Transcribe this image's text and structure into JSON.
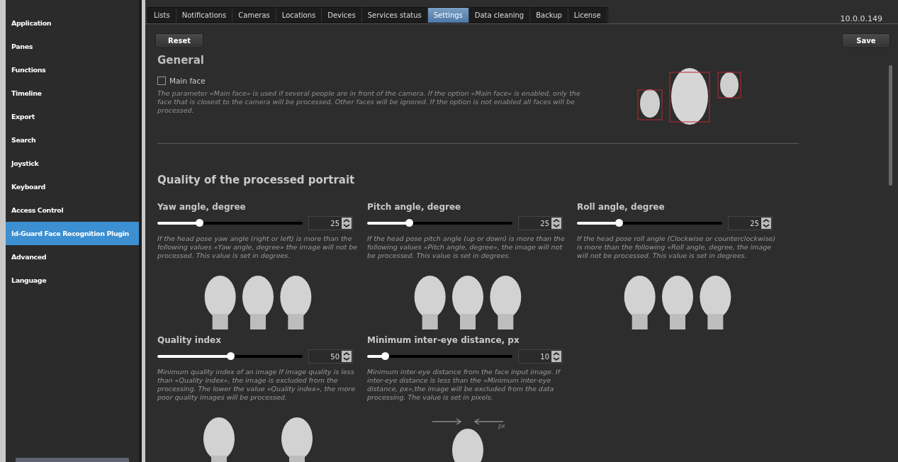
{
  "sidebar": {
    "items": [
      {
        "label": "Application",
        "selected": false
      },
      {
        "label": "Panes",
        "selected": false
      },
      {
        "label": "Functions",
        "selected": false
      },
      {
        "label": "Timeline",
        "selected": false
      },
      {
        "label": "Export",
        "selected": false
      },
      {
        "label": "Search",
        "selected": false
      },
      {
        "label": "Joystick",
        "selected": false
      },
      {
        "label": "Keyboard",
        "selected": false
      },
      {
        "label": "Access Control",
        "selected": false
      },
      {
        "label": "Id-Guard Face Recognition Plugin",
        "selected": true
      },
      {
        "label": "Advanced",
        "selected": false
      },
      {
        "label": "Language",
        "selected": false
      }
    ]
  },
  "tabs": [
    {
      "label": "Lists",
      "selected": false
    },
    {
      "label": "Notifications",
      "selected": false
    },
    {
      "label": "Cameras",
      "selected": false
    },
    {
      "label": "Locations",
      "selected": false
    },
    {
      "label": "Devices",
      "selected": false
    },
    {
      "label": "Services status",
      "selected": false
    },
    {
      "label": "Settings",
      "selected": true
    },
    {
      "label": "Data cleaning",
      "selected": false
    },
    {
      "label": "Backup",
      "selected": false
    },
    {
      "label": "License",
      "selected": false
    }
  ],
  "version": "10.0.0.149",
  "buttons": {
    "reset": "Reset",
    "save": "Save"
  },
  "general": {
    "title": "General",
    "main_face": {
      "label": "Main face",
      "checked": false
    },
    "description": "The parameter «Main face» is used if several people are in front of the camera. If the option «Main face» is enabled, only the face that is closest to the camera will be processed. Other faces will be ignored. If the option is not enabled all faces will be processed."
  },
  "quality": {
    "title": "Quality of the processed portrait",
    "settings": [
      {
        "title": "Yaw angle, degree",
        "level": 0.29,
        "value": "25",
        "description": "If  the head pose yaw angle (right or left) is more than the following values «Yaw angle, degree» the image will not be processed. This value is set in degrees.",
        "illustration": {
          "kind": "three-heads"
        }
      },
      {
        "title": "Pitch angle, degree",
        "level": 0.29,
        "value": "25",
        "description": "If  the head pose pitch angle (up or down) is more than the following values «Pitch angle, degree», the image will not be processed. This value is set in degrees.",
        "illustration": {
          "kind": "three-heads"
        }
      },
      {
        "title": "Roll angle, degree",
        "level": 0.29,
        "value": "25",
        "description": "If  the head pose roll angle (Clockwise or counterclockwise) is more than the following «Roll angle, degree, the image will not be processed. This value is set in degrees.",
        "illustration": {
          "kind": "three-heads"
        }
      },
      {
        "title": "Quality index",
        "level": 0.5,
        "value": "50",
        "description": "Minimum quality index of an image If image quality is less than «Quality index», the image is excluded from the processing. The lower the value «Quality index», the more poor quality images will be processed.",
        "illustration": {
          "kind": "two-heads"
        }
      },
      {
        "title": "Minimum inter-eye distance, px",
        "level": 0.12,
        "value": "10",
        "description": "Minimum inter-eye distance from the face input image. If inter-eye distance is less than the «Minimum inter-eye distance, px»,the image will be excluded from the data processing. The value is set in pixels.",
        "illustration": {
          "kind": "eye-distance",
          "label": "px"
        }
      }
    ]
  }
}
